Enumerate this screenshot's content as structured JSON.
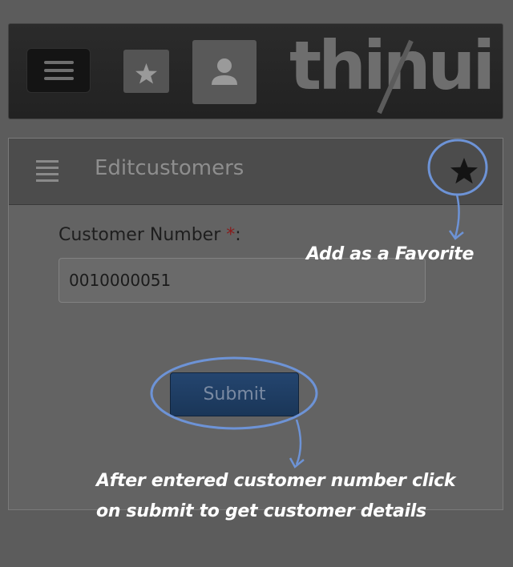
{
  "header": {
    "menu_icon": "hamburger-icon",
    "favorites_icon": "star-icon",
    "profile_icon": "user-icon",
    "logo_text": "thinui"
  },
  "panel": {
    "list_icon": "list-icon",
    "title": "Editcustomers",
    "favorite_icon": "star-icon"
  },
  "form": {
    "customer_number_label": "Customer Number ",
    "required_marker": "*",
    "label_colon": ":",
    "customer_number_value": "0010000051",
    "submit_label": "Submit"
  },
  "annotations": {
    "favorite_note": "Add as a Favorite",
    "submit_note_line1": "After entered customer number click",
    "submit_note_line2": "on submit to get customer details",
    "highlight_color": "#6d93d6"
  },
  "colors": {
    "background": "#5c5c5c",
    "submit_button": "#24456f",
    "required": "#8b1a1a"
  }
}
